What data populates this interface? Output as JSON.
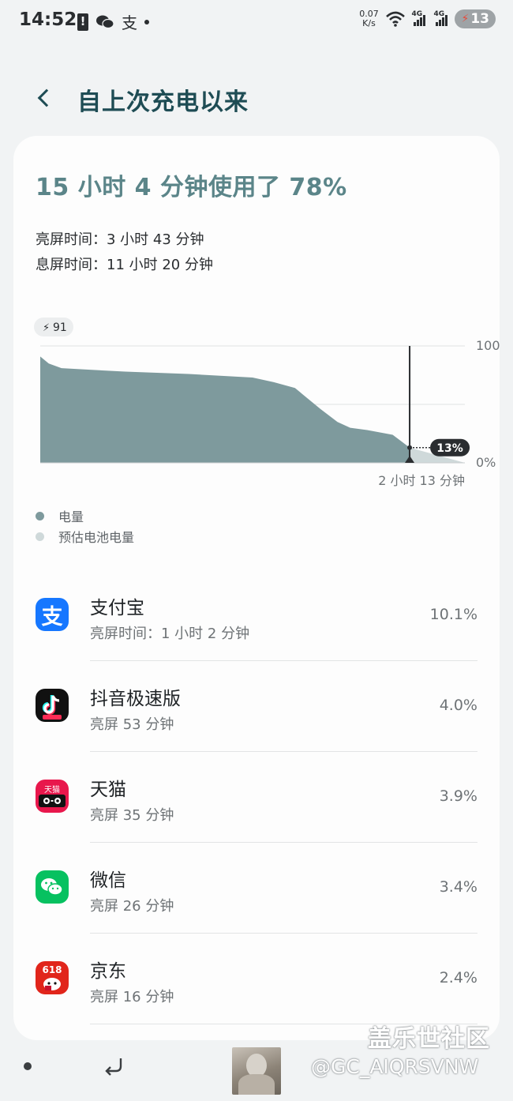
{
  "status_bar": {
    "time": "14:52",
    "alipay_glyph": "支",
    "net_speed_value": "0.07",
    "net_speed_unit": "K/s",
    "signal_label": "4G",
    "battery_level": "13"
  },
  "header": {
    "title": "自上次充电以来"
  },
  "summary": {
    "headline": "15 小时 4 分钟使用了 78%",
    "screen_on": "亮屏时间：3 小时 43 分钟",
    "screen_off": "息屏时间：11 小时 20 分钟"
  },
  "chart_data": {
    "type": "area",
    "start_badge": "91",
    "y_tick_top": "100",
    "y_tick_bottom": "0%",
    "ylim": [
      0,
      100
    ],
    "current_label": "13%",
    "remaining_label": "2 小时 13 分钟",
    "series": [
      {
        "name": "电量",
        "color": "#7e9a9d",
        "x": [
          0,
          0.02,
          0.05,
          0.1,
          0.2,
          0.35,
          0.5,
          0.55,
          0.6,
          0.63,
          0.66,
          0.7,
          0.73,
          0.77,
          0.83,
          0.87
        ],
        "values": [
          91,
          85,
          81,
          80,
          78,
          76,
          73,
          69,
          64,
          55,
          46,
          35,
          30,
          28,
          24,
          13
        ]
      },
      {
        "name": "预估电池电量",
        "color": "#cfd9da",
        "x": [
          0.87,
          1.0
        ],
        "values": [
          13,
          0
        ]
      }
    ],
    "marker_x": 0.87
  },
  "legend": {
    "items": [
      {
        "label": "电量",
        "color": "#7e9a9d"
      },
      {
        "label": "预估电池电量",
        "color": "#cfd9da"
      }
    ]
  },
  "apps": [
    {
      "name": "支付宝",
      "sub": "亮屏时间：1 小时 2 分钟",
      "percent": "10.1%",
      "icon": "alipay-icon",
      "icon_glyph": "支",
      "color": "#1677ff"
    },
    {
      "name": "抖音极速版",
      "sub": "亮屏 53 分钟",
      "percent": "4.0%",
      "icon": "douyin-icon",
      "icon_glyph": "♪",
      "color": "#111111"
    },
    {
      "name": "天猫",
      "sub": "亮屏 35 分钟",
      "percent": "3.9%",
      "icon": "tmall-icon",
      "icon_glyph": "天猫",
      "color": "#e8174c"
    },
    {
      "name": "微信",
      "sub": "亮屏 26 分钟",
      "percent": "3.4%",
      "icon": "wechat-icon",
      "icon_glyph": "",
      "color": "#07c160"
    },
    {
      "name": "京东",
      "sub": "亮屏 16 分钟",
      "percent": "2.4%",
      "icon": "jd-icon",
      "icon_glyph": "618",
      "color": "#e1251b"
    }
  ],
  "watermark": {
    "line1": "盖乐世社区",
    "line2": "@GC_AIQRSVNW"
  }
}
